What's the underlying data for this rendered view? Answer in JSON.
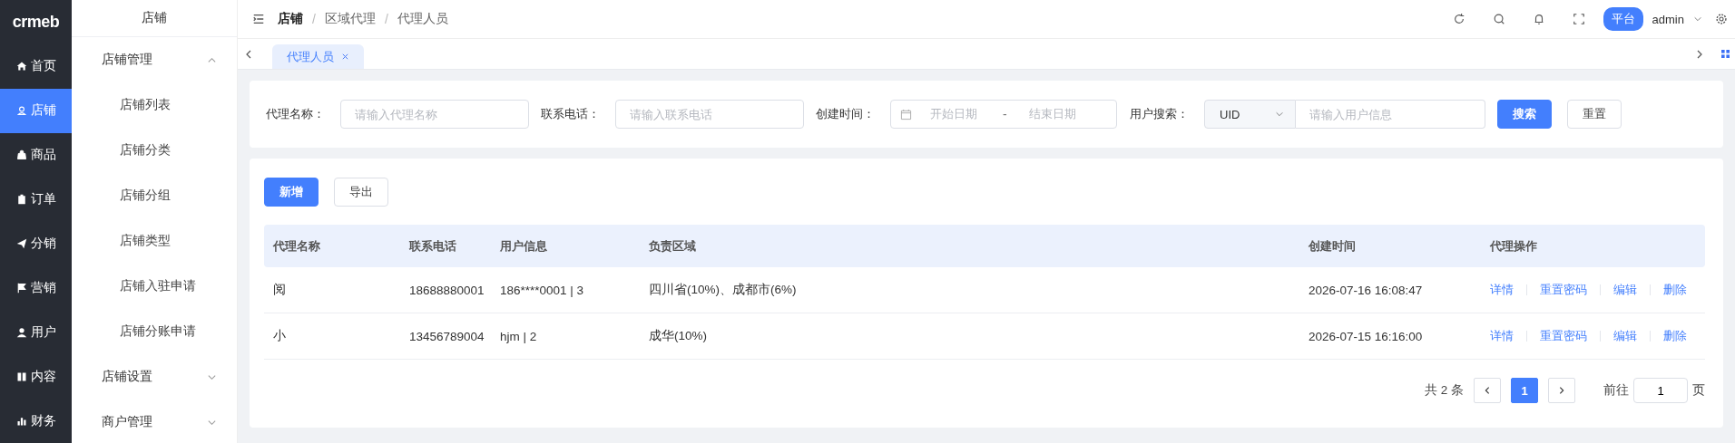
{
  "logo": {
    "text": "crmeb"
  },
  "nav": [
    {
      "label": "首页",
      "selected": false
    },
    {
      "label": "店铺",
      "selected": true
    },
    {
      "label": "商品",
      "selected": false
    },
    {
      "label": "订单",
      "selected": false
    },
    {
      "label": "分销",
      "selected": false
    },
    {
      "label": "营销",
      "selected": false
    },
    {
      "label": "用户",
      "selected": false
    },
    {
      "label": "内容",
      "selected": false
    },
    {
      "label": "财务",
      "selected": false
    }
  ],
  "submenu": {
    "title": "店铺",
    "groups": [
      {
        "label": "店铺管理",
        "expanded": true,
        "children": [
          {
            "label": "店铺列表"
          },
          {
            "label": "店铺分类"
          },
          {
            "label": "店铺分组"
          },
          {
            "label": "店铺类型"
          },
          {
            "label": "店铺入驻申请"
          },
          {
            "label": "店铺分账申请"
          }
        ]
      },
      {
        "label": "店铺设置",
        "expanded": false
      },
      {
        "label": "商户管理",
        "expanded": false
      }
    ]
  },
  "breadcrumb": {
    "separator": "/",
    "items": [
      "店铺",
      "区域代理",
      "代理人员"
    ]
  },
  "header": {
    "platform_badge": "平台",
    "user": "admin"
  },
  "tabs": [
    {
      "label": "代理人员",
      "selected": true
    }
  ],
  "filters": {
    "name": {
      "label": "代理名称：",
      "placeholder": "请输入代理名称"
    },
    "phone": {
      "label": "联系电话：",
      "placeholder": "请输入联系电话"
    },
    "created": {
      "label": "创建时间：",
      "start_placeholder": "开始日期",
      "separator": "-",
      "end_placeholder": "结束日期"
    },
    "user": {
      "label": "用户搜索：",
      "select_value": "UID",
      "placeholder": "请输入用户信息"
    },
    "search_button": "搜索",
    "reset_button": "重置"
  },
  "toolbar": {
    "add_button": "新增",
    "export_button": "导出"
  },
  "table": {
    "columns": [
      "代理名称",
      "联系电话",
      "用户信息",
      "负责区域",
      "创建时间",
      "代理操作"
    ],
    "rows": [
      {
        "name": "阅",
        "phone": "18688880001",
        "user": "186****0001 | 3",
        "region": "四川省(10%)、成都市(6%)",
        "created": "2026-07-16 16:08:47",
        "actions": [
          "详情",
          "重置密码",
          "编辑",
          "删除"
        ]
      },
      {
        "name": "小",
        "phone": "13456789004",
        "user": "hjm | 2",
        "region": "成华(10%)",
        "created": "2026-07-15 16:16:00",
        "actions": [
          "详情",
          "重置密码",
          "编辑",
          "删除"
        ]
      }
    ]
  },
  "pagination": {
    "total": "共 2 条",
    "pages": [
      {
        "label": "1",
        "selected": true
      }
    ],
    "goto_label": "前往",
    "goto_value": "1",
    "goto_suffix": "页"
  }
}
